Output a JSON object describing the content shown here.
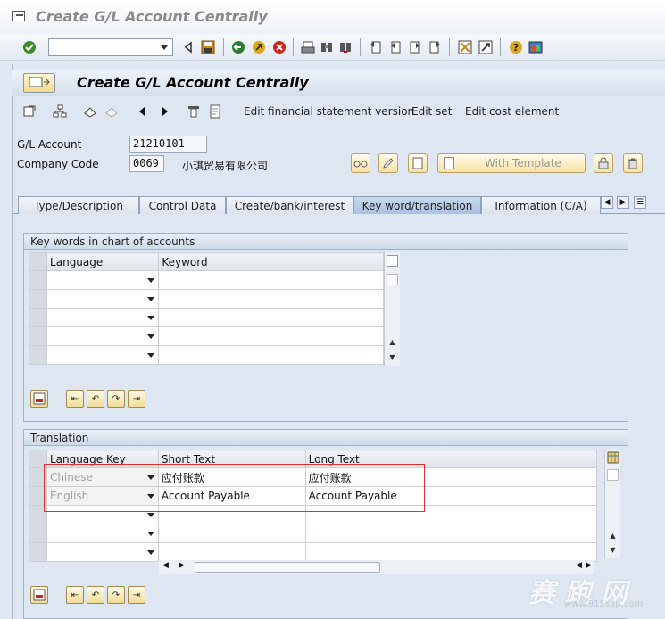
{
  "window": {
    "title": "Create G/L Account Centrally"
  },
  "toolbar": {
    "command_value": ""
  },
  "screen": {
    "title": "Create G/L Account Centrally",
    "app_buttons": [
      "Edit financial statement version",
      "Edit set",
      "Edit cost element"
    ]
  },
  "header": {
    "gl_account_label": "G/L Account",
    "gl_account_value": "21210101",
    "company_code_label": "Company Code",
    "company_code_value": "0069",
    "company_name": "小琪贸易有限公司",
    "with_template_label": "With Template"
  },
  "tabs": [
    {
      "label": "Type/Description",
      "active": false
    },
    {
      "label": "Control Data",
      "active": false
    },
    {
      "label": "Create/bank/interest",
      "active": false
    },
    {
      "label": "Key word/translation",
      "active": true
    },
    {
      "label": "Information (C/A)",
      "active": false
    }
  ],
  "keywords_group": {
    "title": "Key words in chart of accounts",
    "columns": [
      "Language",
      "Keyword"
    ],
    "rows": [
      {
        "language": "",
        "keyword": ""
      },
      {
        "language": "",
        "keyword": ""
      },
      {
        "language": "",
        "keyword": ""
      },
      {
        "language": "",
        "keyword": ""
      },
      {
        "language": "",
        "keyword": ""
      }
    ]
  },
  "translation_group": {
    "title": "Translation",
    "columns": [
      "Language Key",
      "Short Text",
      "Long Text"
    ],
    "rows": [
      {
        "language": "Chinese",
        "short": "应付账款",
        "long": "应付账款"
      },
      {
        "language": "English",
        "short": "Account Payable",
        "long": "Account Payable"
      },
      {
        "language": "",
        "short": "",
        "long": ""
      },
      {
        "language": "",
        "short": "",
        "long": ""
      },
      {
        "language": "",
        "short": "",
        "long": ""
      }
    ]
  },
  "watermark": {
    "main": "赛 跑 网",
    "sub": "www.915sap.com"
  },
  "colors": {
    "highlight_box": "#e03030",
    "tab_active": "#a9c1e0"
  }
}
